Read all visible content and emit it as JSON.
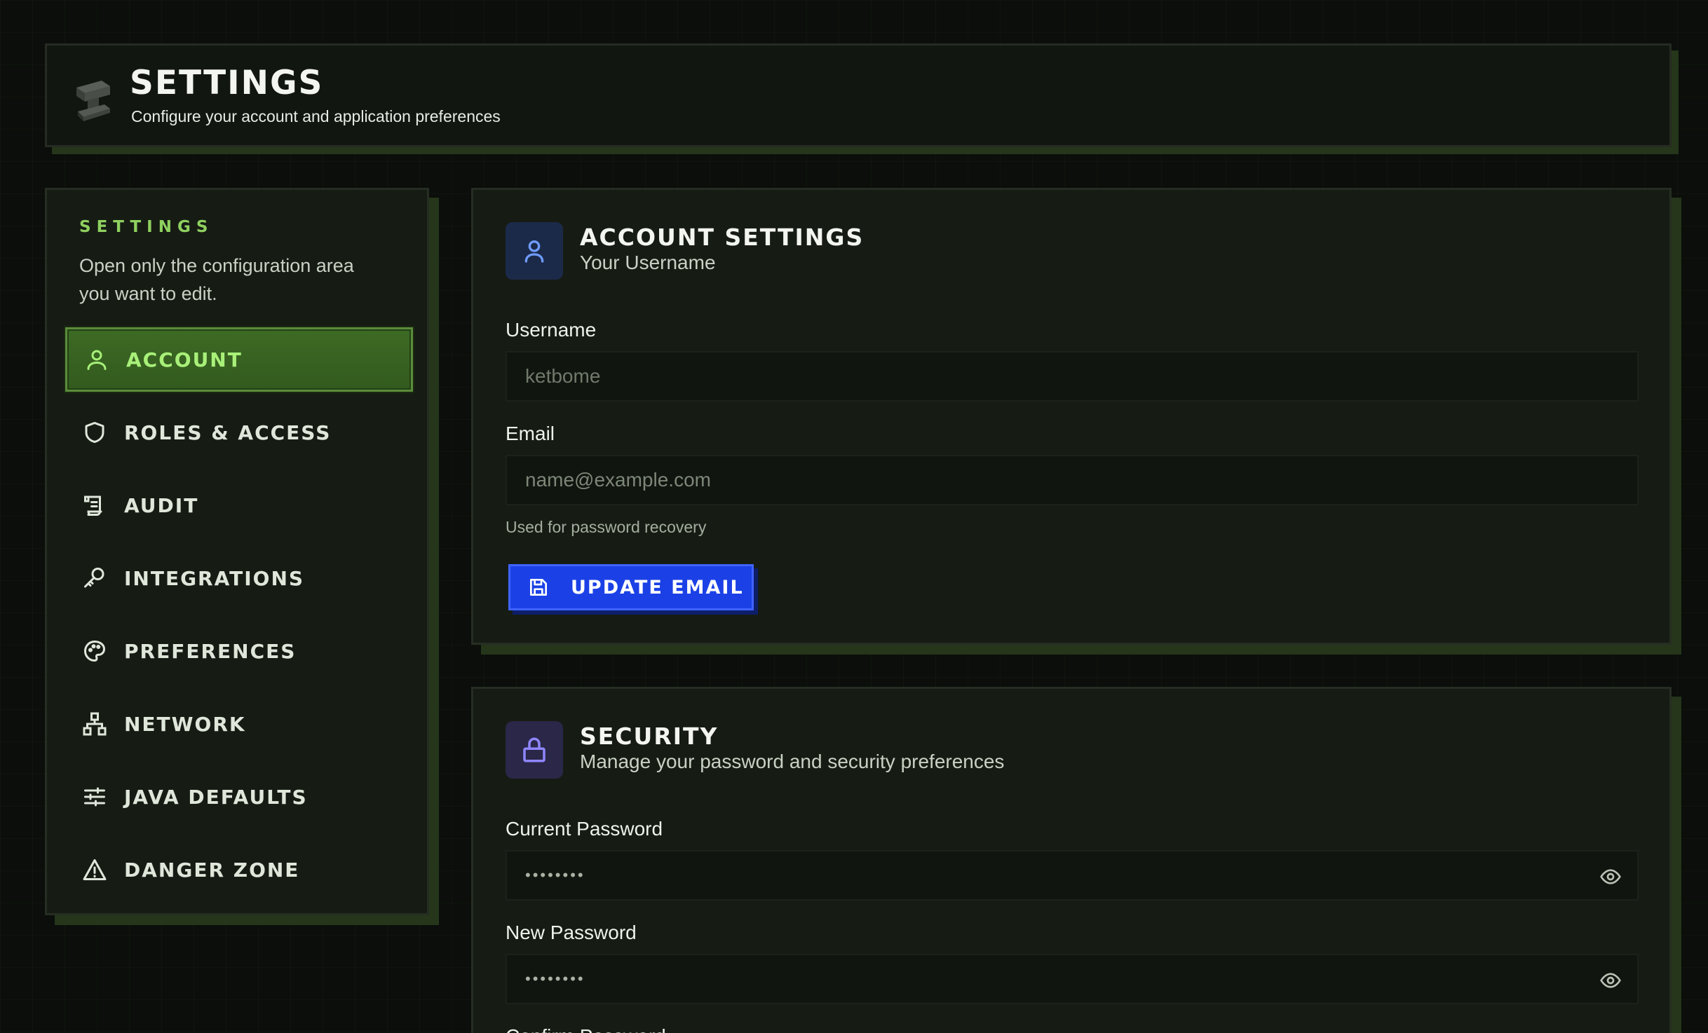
{
  "header": {
    "title": "SETTINGS",
    "subtitle": "Configure your account and application preferences"
  },
  "sidebar": {
    "heading": "SETTINGS",
    "description": "Open only the configuration area you want to edit.",
    "items": [
      {
        "label": "ACCOUNT",
        "icon": "user-icon",
        "active": true
      },
      {
        "label": "ROLES & ACCESS",
        "icon": "shield-icon",
        "active": false
      },
      {
        "label": "AUDIT",
        "icon": "scroll-icon",
        "active": false
      },
      {
        "label": "INTEGRATIONS",
        "icon": "key-icon",
        "active": false
      },
      {
        "label": "PREFERENCES",
        "icon": "palette-icon",
        "active": false
      },
      {
        "label": "NETWORK",
        "icon": "network-icon",
        "active": false
      },
      {
        "label": "JAVA DEFAULTS",
        "icon": "sliders-icon",
        "active": false
      },
      {
        "label": "DANGER ZONE",
        "icon": "warning-icon",
        "active": false
      }
    ]
  },
  "account": {
    "title": "ACCOUNT SETTINGS",
    "subtitle": "Your Username",
    "username_label": "Username",
    "username_value": "ketbome",
    "email_label": "Email",
    "email_placeholder": "name@example.com",
    "email_help": "Used for password recovery",
    "update_button": "UPDATE EMAIL"
  },
  "security": {
    "title": "SECURITY",
    "subtitle": "Manage your password and security preferences",
    "current_password_label": "Current Password",
    "current_password_value": "••••••••",
    "new_password_label": "New Password",
    "new_password_value": "••••••••",
    "confirm_password_label": "Confirm Password"
  },
  "colors": {
    "accent_green": "#8fd15f",
    "active_nav_bg": "#3d6a24",
    "button_blue": "#1b41e6",
    "account_icon_bg": "#1c2a4a",
    "security_icon_bg": "#2a2748"
  }
}
